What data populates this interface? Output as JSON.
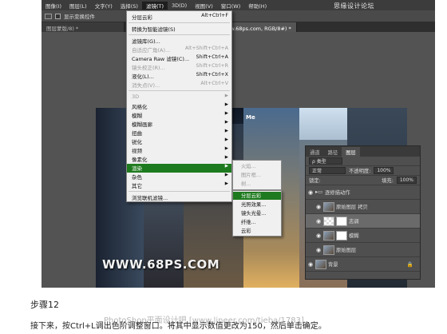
{
  "menubar": {
    "items": [
      "图像(I)",
      "图层(L)",
      "文字(Y)",
      "选择(S)",
      "滤镜(T)",
      "3D(D)",
      "视图(V)",
      "窗口(W)",
      "帮助(H)"
    ],
    "watermark": "思缘设计论坛"
  },
  "optbar": {
    "auto_select": "显示变换控件"
  },
  "tabs": [
    "图层蒙版/8) *",
    "未标题-1 @ 66.7% (www.68ps.com, RGB/8#) *"
  ],
  "filter_menu": {
    "last_filter": "分层云彩",
    "last_filter_shortcut": "Alt+Ctrl+F",
    "convert_smart": "转换为智能滤镜(S)",
    "gallery": "滤镜库(G)...",
    "adaptive_wide": "自适应广角(A)...",
    "adaptive_wide_shortcut": "Alt+Shift+Ctrl+A",
    "camera_raw": "Camera Raw 滤镜(C)...",
    "camera_raw_shortcut": "Shift+Ctrl+A",
    "lens_correction": "镜头校正(R)...",
    "lens_correction_shortcut": "Shift+Ctrl+R",
    "liquify": "液化(L)...",
    "liquify_shortcut": "Shift+Ctrl+X",
    "vanishing_point": "消失点(V)...",
    "vanishing_point_shortcut": "Alt+Ctrl+V",
    "categories": [
      "3D",
      "风格化",
      "模糊",
      "模糊画廊",
      "扭曲",
      "锐化",
      "视频",
      "像素化",
      "渲染",
      "杂色",
      "其它"
    ],
    "browse_online": "浏览联机滤镜..."
  },
  "submenu_render_upper": [
    "火焰...",
    "图片框...",
    "树..."
  ],
  "submenu_render": [
    "分层云彩",
    "光照效果...",
    "镜头光晕...",
    "纤维...",
    "云彩"
  ],
  "layers_panel": {
    "tabs": [
      "通道",
      "路径",
      "图层"
    ],
    "kind": "ρ 类型",
    "blend_mode": "正常",
    "opacity_label": "不透明度:",
    "opacity": "100%",
    "lock_label": "锁定:",
    "fill_label": "填充:",
    "fill": "100%",
    "layers": [
      "逐修描动作",
      "原始图层 拷贝",
      "志调",
      "模糊",
      "原始图层",
      "背景"
    ]
  },
  "canvas": {
    "watermark": "WWW.68PS.COM",
    "sign_text": "Me"
  },
  "article": {
    "step": "步骤12",
    "desc": "接下来，按Ctrl+L调出色阶调整窗口。将其中显示数值更改为150，然后单击确定。",
    "footer_watermark": "PhotoShop平面设计吧 [www.lineer.com/tieba/1783]"
  }
}
